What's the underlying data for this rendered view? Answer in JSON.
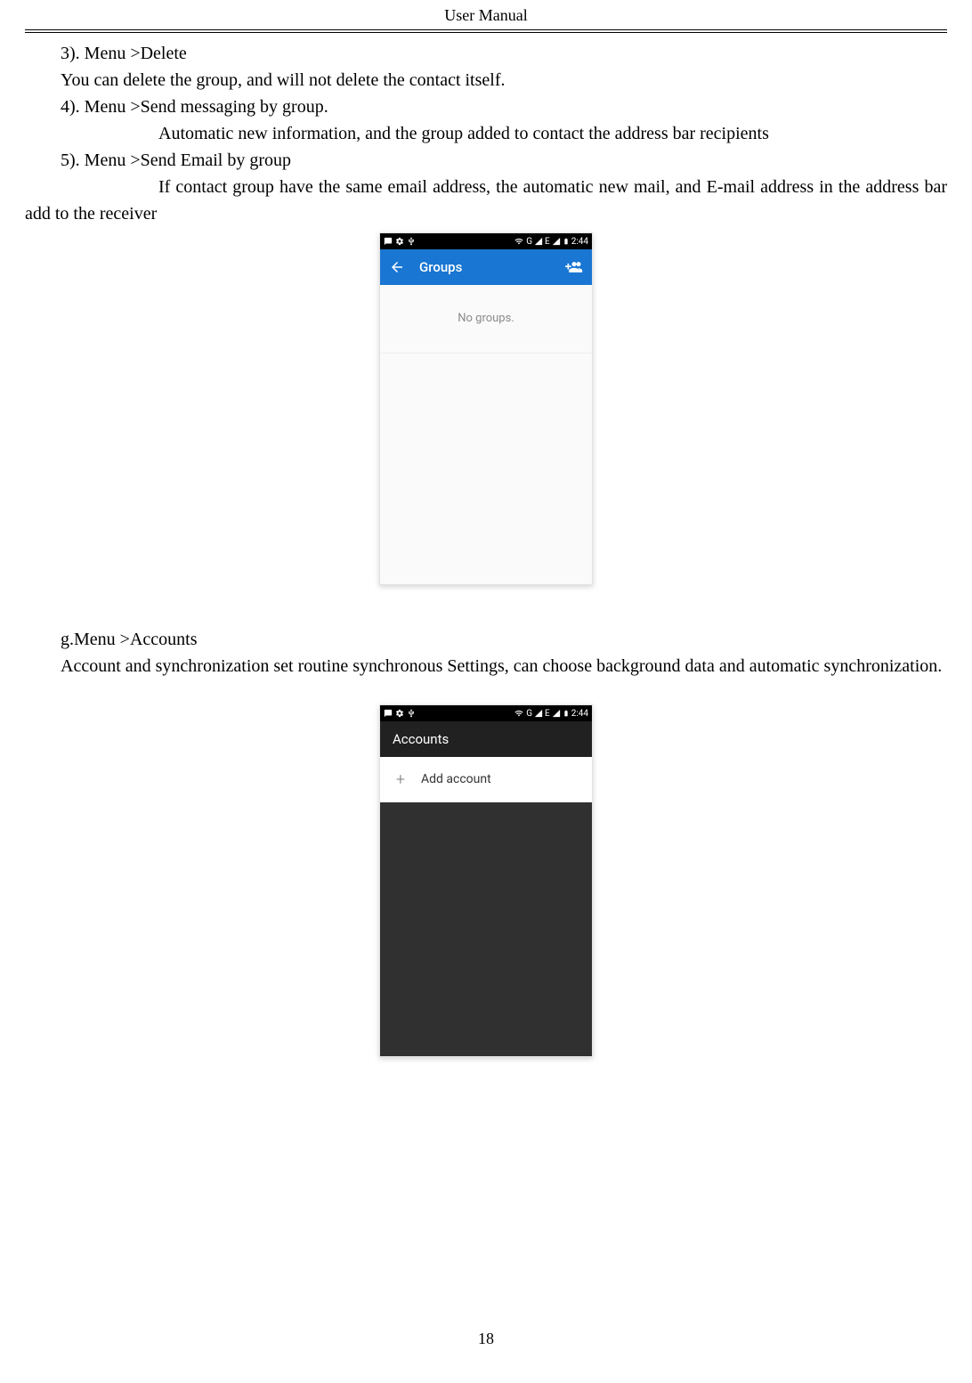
{
  "header": {
    "title": "User    Manual"
  },
  "text": {
    "p1": "3).    Menu >Delete",
    "p2": "You can delete the group, and will not delete the contact itself.",
    "p3": "4).    Menu >Send messaging by group.",
    "p4": "Automatic new information, and the group added to contact the address bar recipients",
    "p5": "5).    Menu >Send Email by group",
    "p6": "If contact group have the same email address, the automatic new mail, and E-mail address in the address bar add to the receiver",
    "p7": "g.Menu >Accounts",
    "p8": "Account and synchronization set routine synchronous Settings, can choose background data and automatic synchronization."
  },
  "screenshot1": {
    "status": {
      "time": "2:44",
      "signal_g": "G",
      "signal_e": "E"
    },
    "appbar": {
      "title": "Groups"
    },
    "body": {
      "empty": "No groups."
    }
  },
  "screenshot2": {
    "status": {
      "time": "2:44",
      "signal_g": "G",
      "signal_e": "E"
    },
    "appbar": {
      "title": "Accounts"
    },
    "list": {
      "add_account": "Add account"
    }
  },
  "footer": {
    "page": "18"
  }
}
